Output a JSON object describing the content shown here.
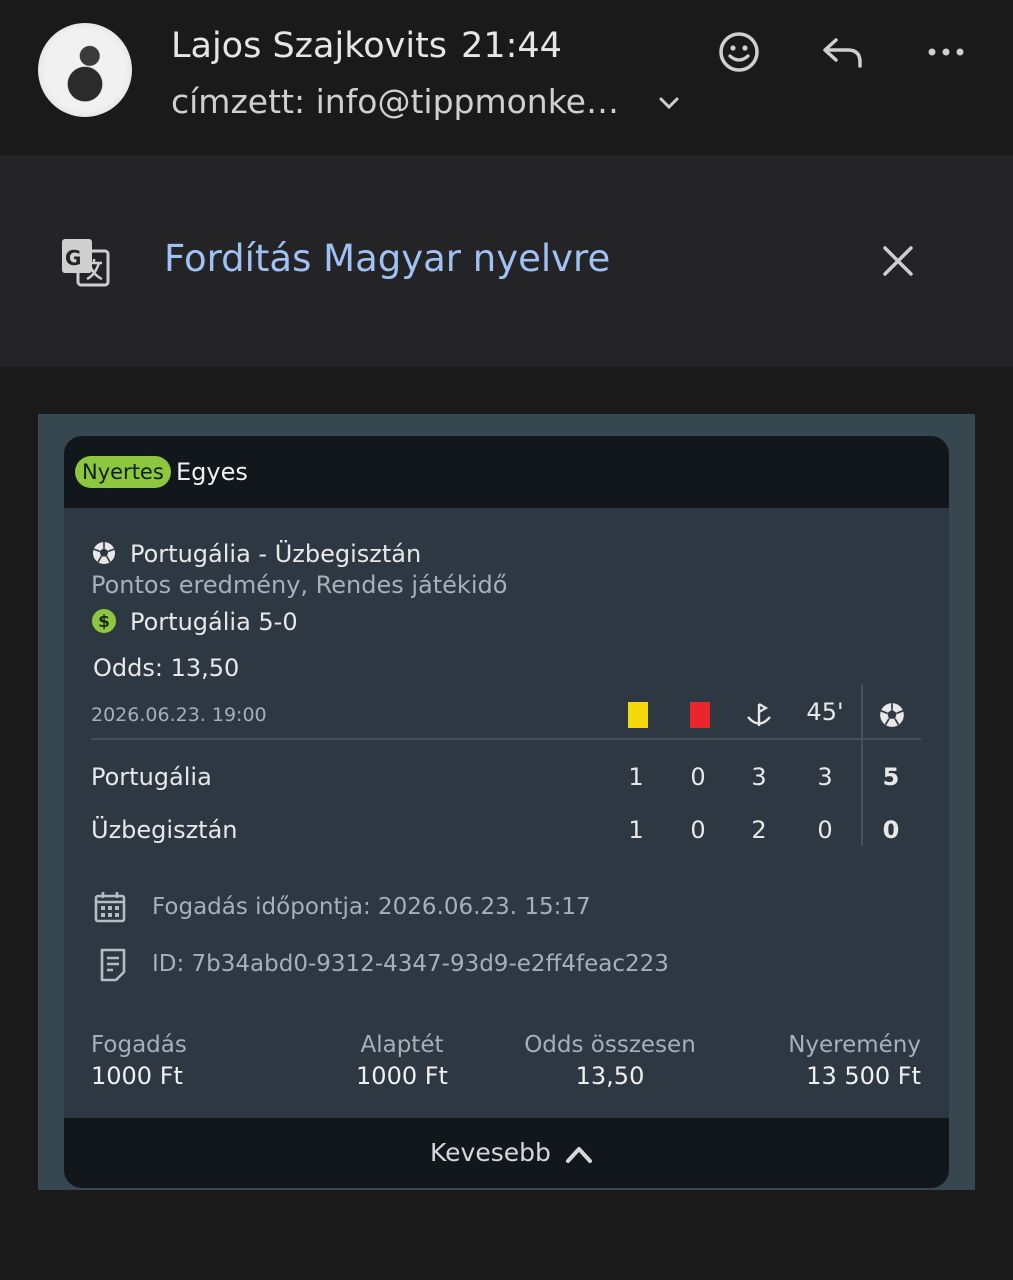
{
  "header": {
    "sender": "Lajos Szajkovits",
    "time": "21:44",
    "recipient": "címzett: info@tippmonke…",
    "icons": [
      "smiley-icon",
      "reply-icon",
      "more-icon"
    ]
  },
  "translate": {
    "label": "Fordítás Magyar nyelvre"
  },
  "card": {
    "badge": "Nyertes",
    "bet_type": "Egyes",
    "match": "Portugália - Üzbegisztán",
    "market": "Pontos eredmény, Rendes játékidő",
    "pick": "Portugália 5-0",
    "odds": "Odds: 13,50",
    "datetime": "2026.06.23. 19:00",
    "stats_header": {
      "minute": "45'"
    },
    "rows": [
      {
        "team": "Portugália",
        "yellow": "1",
        "red": "0",
        "corners": "3",
        "half": "3",
        "goals": "5"
      },
      {
        "team": "Üzbegisztán",
        "yellow": "1",
        "red": "0",
        "corners": "2",
        "half": "0",
        "goals": "0"
      }
    ],
    "bet_time": "Fogadás időpontja:  2026.06.23.  15:17",
    "bet_id": "ID: 7b34abd0-9312-4347-93d9-e2ff4feac223",
    "summary": [
      {
        "label": "Fogadás",
        "value": "1000 Ft"
      },
      {
        "label": "Alaptét",
        "value": "1000 Ft"
      },
      {
        "label": "Odds összesen",
        "value": "13,50"
      },
      {
        "label": "Nyeremény",
        "value": "13 500 Ft"
      }
    ],
    "less_label": "Kevesebb",
    "colors": {
      "badge": "#8dc63f",
      "yellow_card": "#f5d90a",
      "red_card": "#e8262b",
      "link": "#9fc1f3"
    }
  }
}
